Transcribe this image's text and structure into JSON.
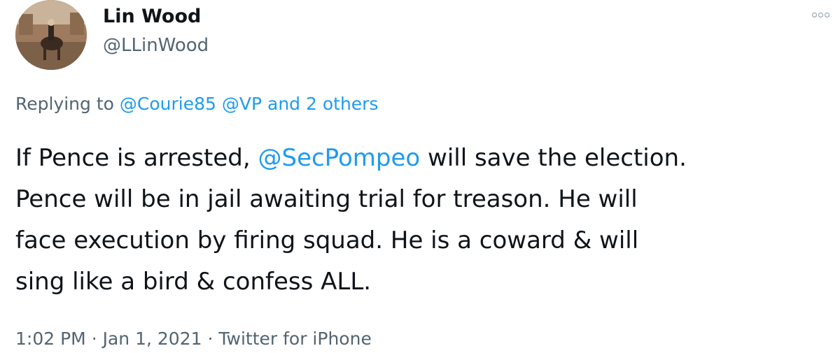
{
  "author": {
    "name": "Lin Wood",
    "handle": "@LLinWood"
  },
  "reply": {
    "prefix": "Replying to",
    "mention_1": "@Courie85",
    "mention_2": "@VP",
    "suffix": "and 2 others"
  },
  "tweet": {
    "line1_a": "If Pence is arrested,",
    "line1_mention": "@SecPompeo",
    "line1_b": "will save the election.",
    "line2": "Pence will be in jail awaiting trial for treason. He will",
    "line3": "face execution by firing squad. He is a coward & will",
    "line4": "sing like a bird & confess ALL."
  },
  "meta": {
    "time": "1:02 PM",
    "separator": "·",
    "date": "Jan 1, 2021",
    "source": "Twitter for iPhone"
  },
  "icons": {
    "more": "more-options-icon"
  },
  "colors": {
    "link": "#1d9bf0",
    "secondary_text": "#536471",
    "primary_text": "#0f1419"
  }
}
